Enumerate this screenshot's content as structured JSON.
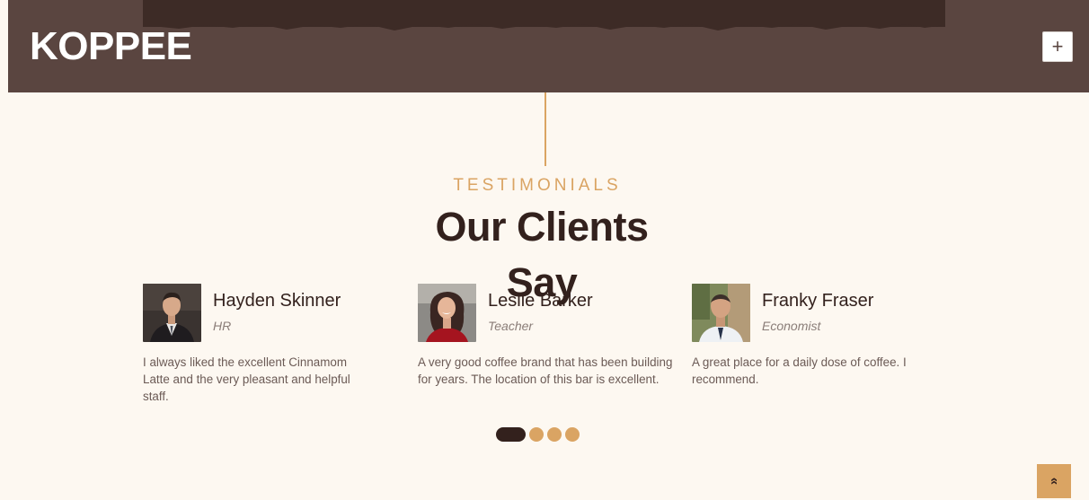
{
  "header": {
    "brand": "KOPPEE",
    "menu_toggle": "+"
  },
  "section": {
    "kicker": "TESTIMONIALS",
    "title": "Our Clients Say"
  },
  "testimonials": [
    {
      "name": "Hayden Skinner",
      "role": "HR",
      "quote": "I always liked the excellent Cinnamom Latte and the very pleasant and helpful staff."
    },
    {
      "name": "Leslie Barker",
      "role": "Teacher",
      "quote": "A very good coffee brand that has been building for years. The location of this bar is excellent."
    },
    {
      "name": "Franky Fraser",
      "role": "Economist",
      "quote": "A great place for a daily dose of coffee. I recommend."
    }
  ],
  "carousel": {
    "total_dots": 4,
    "active_index": 0
  },
  "back_to_top": {
    "icon": "double-chevron-up-icon",
    "glyph": "»"
  },
  "colors": {
    "header": "#5a4540",
    "accent": "#daa463",
    "dark": "#33211d",
    "background": "#fdf8f1"
  }
}
